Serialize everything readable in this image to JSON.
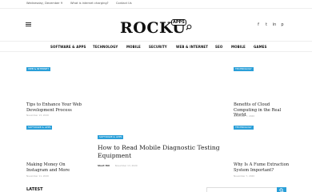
{
  "topbar": {
    "date": "Wednesday, December 9",
    "links": [
      "What is internet charging?",
      "Contact Us"
    ]
  },
  "logo": {
    "word": "ROCKU",
    "badge": "APPS"
  },
  "social": [
    "facebook-icon",
    "twitter-icon",
    "linkedin-icon",
    "pinterest-icon"
  ],
  "social_glyphs": [
    "f",
    "t",
    "in",
    "p"
  ],
  "nav": {
    "items": [
      "SOFTWARE & APPS",
      "TECHNOLOGY",
      "MOBILE",
      "SECURITY",
      "WEB & INTERNET",
      "SEO",
      "MOBILE",
      "GAMES"
    ]
  },
  "cards": {
    "top_left": {
      "tag": "WEB & INTERNET",
      "title": "Tips to Enhance Your Web Development Process",
      "date": "November 13, 2020"
    },
    "top_right": {
      "tag": "TECHNOLOGY",
      "title": "Benefits of Cloud Computing in the Real World",
      "date": "November 7, 2020"
    },
    "bottom_left": {
      "tag": "SOFTWARE & APPS",
      "title": "Making Money On Instagram and More",
      "date": "November 11, 2020"
    },
    "bottom_right": {
      "tag": "TECHNOLOGY",
      "title": "Why Is A Fume Extraction System Important?",
      "date": "November 7, 2020"
    }
  },
  "feature": {
    "tag": "SOFTWARE & APPS",
    "title": "How to Read Mobile Diagnostic Testing Equipment",
    "author": "Short Hill",
    "date": "November 13, 2020"
  },
  "bottom": {
    "heading": "LATEST"
  },
  "colors": {
    "accent": "#2a9fd8"
  }
}
